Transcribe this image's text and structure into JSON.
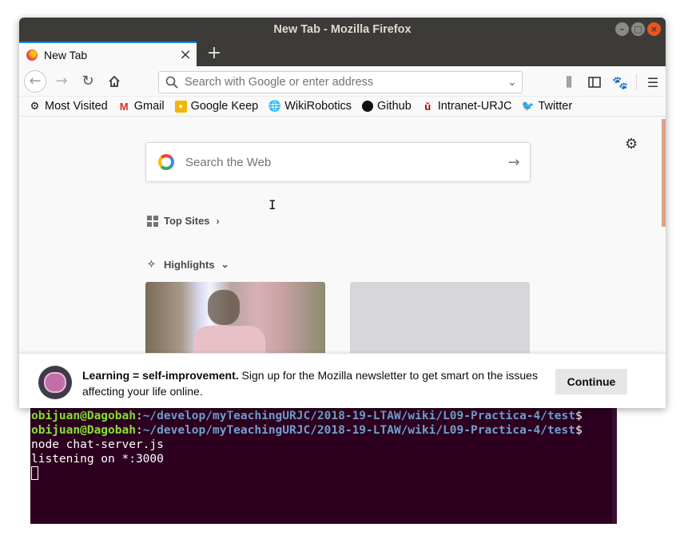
{
  "terminal": {
    "lines": [
      {
        "user": "obijuan@Dagobah",
        "colon": ":",
        "path": "~/develop/myTeachingURJC/2018-19-LTAW/wiki/L09-Practica-4/test",
        "prompt": "$"
      },
      {
        "user": "obijuan@Dagobah",
        "colon": ":",
        "path": "~/develop/myTeachingURJC/2018-19-LTAW/wiki/L09-Practica-4/test",
        "prompt": "$"
      }
    ],
    "output": [
      "node chat-server.js",
      "listening on *:3000"
    ]
  },
  "window": {
    "title": "New Tab - Mozilla Firefox",
    "controls": {
      "minimize": "–",
      "maximize": "□",
      "close": "×"
    }
  },
  "tab": {
    "label": "New Tab",
    "close": "×",
    "new_tab": "+"
  },
  "navbar": {
    "url_placeholder": "Search with Google or enter address",
    "icons": [
      "back-arrow-icon",
      "forward-arrow-icon",
      "reload-icon",
      "home-icon",
      "search-icon",
      "dropdown-icon",
      "library-icon",
      "sidebar-icon",
      "gnome-icon",
      "hamburger-menu-icon"
    ]
  },
  "bookmarks": [
    {
      "label": "Most Visited",
      "icon": "gear-icon"
    },
    {
      "label": "Gmail",
      "icon": "gmail-icon"
    },
    {
      "label": "Google Keep",
      "icon": "keep-icon"
    },
    {
      "label": "WikiRobotics",
      "icon": "globe-icon"
    },
    {
      "label": "Github",
      "icon": "github-icon"
    },
    {
      "label": "Intranet-URJC",
      "icon": "urjc-icon"
    },
    {
      "label": "Twitter",
      "icon": "twitter-icon"
    }
  ],
  "newtab": {
    "search_placeholder": "Search the Web",
    "top_sites": "Top Sites",
    "highlights": "Highlights"
  },
  "snippet": {
    "bold": "Learning = self-improvement.",
    "text": " Sign up for the Mozilla newsletter to get smart on the issues affecting your life online.",
    "button": "Continue"
  },
  "colors": {
    "terminal_bg": "#2c001e",
    "prompt_user": "#8ae234",
    "prompt_path": "#729fcf",
    "accent": "#0a84ff"
  }
}
